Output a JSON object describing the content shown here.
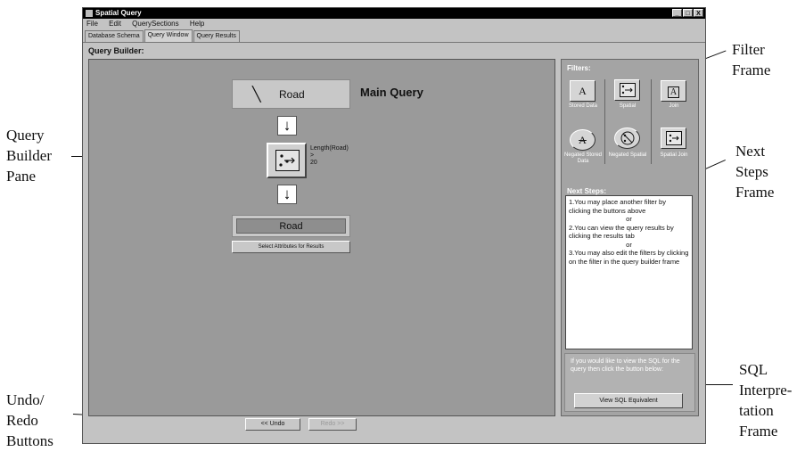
{
  "window": {
    "title": "Spatial Query",
    "controls": [
      "_",
      "□",
      "X"
    ]
  },
  "menu": [
    "File",
    "Edit",
    "QuerySections",
    "Help"
  ],
  "tabs": [
    {
      "label": "Database Schema",
      "active": false
    },
    {
      "label": "Query Window",
      "active": true
    },
    {
      "label": "Query Results",
      "active": false
    }
  ],
  "query_builder": {
    "label": "Query Builder:",
    "main_query": {
      "icon": "line-segment-icon",
      "layer": "Road",
      "title": "Main Query"
    },
    "flow_arrow_icon": "down-arrow-icon",
    "spatial_filter": {
      "icon": "spatial-filter-icon",
      "condition": [
        "Length(Road)",
        ">",
        "20"
      ]
    },
    "result": {
      "layer": "Road",
      "select_attributes_label": "Select Attributes for Results"
    }
  },
  "undo_redo": {
    "undo_label": "<< Undo",
    "redo_label": "Redo >>",
    "redo_enabled": false
  },
  "filters": {
    "label": "Filters:",
    "buttons": [
      {
        "caption": "Stored Data",
        "glyph": "A",
        "icon": "stored-data-icon"
      },
      {
        "caption": "Spatial",
        "glyph": "",
        "icon": "spatial-filter-icon"
      },
      {
        "caption": "Join",
        "glyph": "A",
        "icon": "join-icon"
      },
      {
        "caption": "Negated Stored Data",
        "glyph": "A",
        "icon": "negated-stored-data-icon"
      },
      {
        "caption": "Negated Spatial",
        "glyph": "",
        "icon": "negated-spatial-icon"
      },
      {
        "caption": "Spatial Join",
        "glyph": "",
        "icon": "spatial-join-icon"
      }
    ]
  },
  "next_steps": {
    "label": "Next Steps:",
    "lines": [
      "1.You may place another filter by clicking the buttons above",
      "or",
      "2.You can view the query results by clicking the results tab",
      "or",
      "3.You may also edit the filters by clicking on the filter in the query builder frame"
    ]
  },
  "sql": {
    "text": "If you would like to view the SQL for the query then click the button below:",
    "button_label": "View SQL Equivalent"
  },
  "annotations": {
    "query_builder_pane": [
      "Query",
      "Builder",
      "Pane"
    ],
    "undo_redo_buttons": [
      "Undo/",
      "Redo",
      "Buttons"
    ],
    "filter_frame": [
      "Filter",
      "Frame"
    ],
    "next_steps_frame": [
      "Next",
      "Steps",
      "Frame"
    ],
    "sql_interpretation_frame": [
      "SQL",
      "Interpre-",
      "tation",
      "Frame"
    ]
  }
}
